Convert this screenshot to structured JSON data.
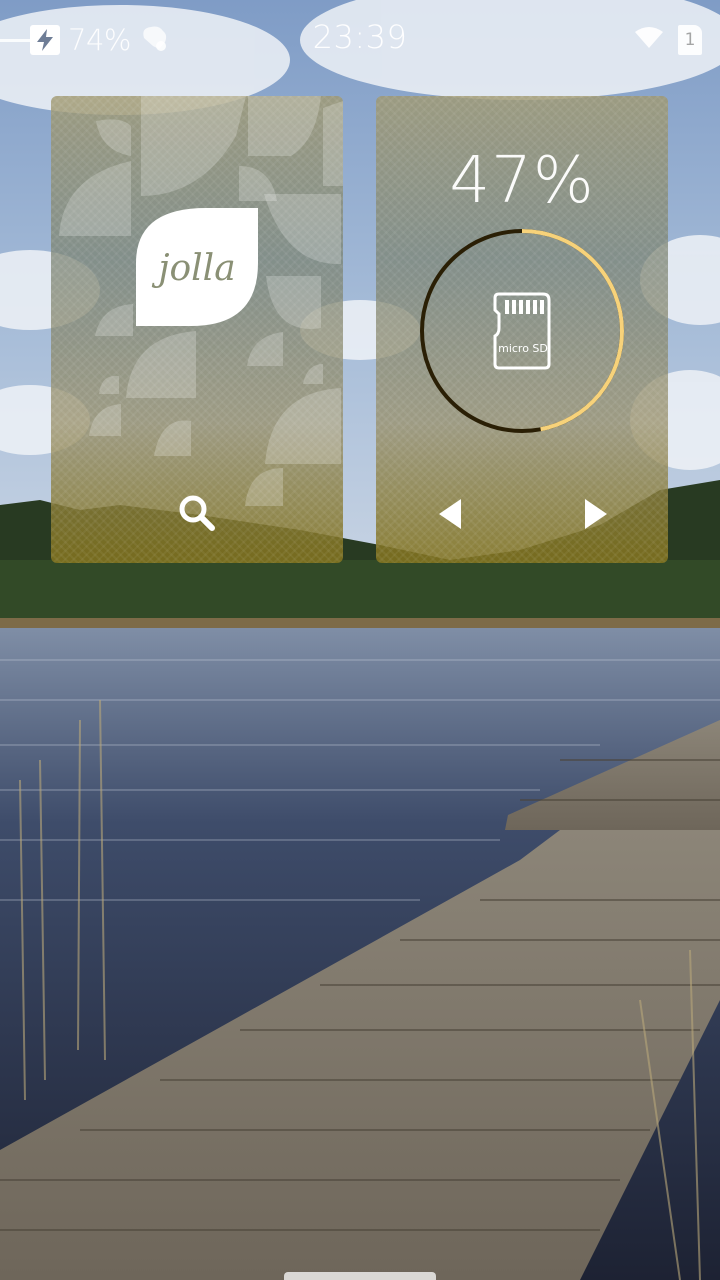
{
  "status_bar": {
    "battery_percent": "74%",
    "time": "23:39",
    "sim_slot": "1",
    "icons": [
      "charging-icon",
      "notification-icon",
      "wifi-icon",
      "sim-card-icon"
    ]
  },
  "covers": {
    "jolla": {
      "logo_text": "jolla",
      "action_icon": "search-icon"
    },
    "storage": {
      "percent_text": "47%",
      "usage_fraction": 0.47,
      "device_icon": "microsd-icon",
      "sd_label": "micro SD",
      "actions": [
        "prev-icon",
        "next-icon"
      ]
    }
  },
  "colors": {
    "ring_progress": "#f7d27a",
    "ring_track": "#2a1f05"
  }
}
